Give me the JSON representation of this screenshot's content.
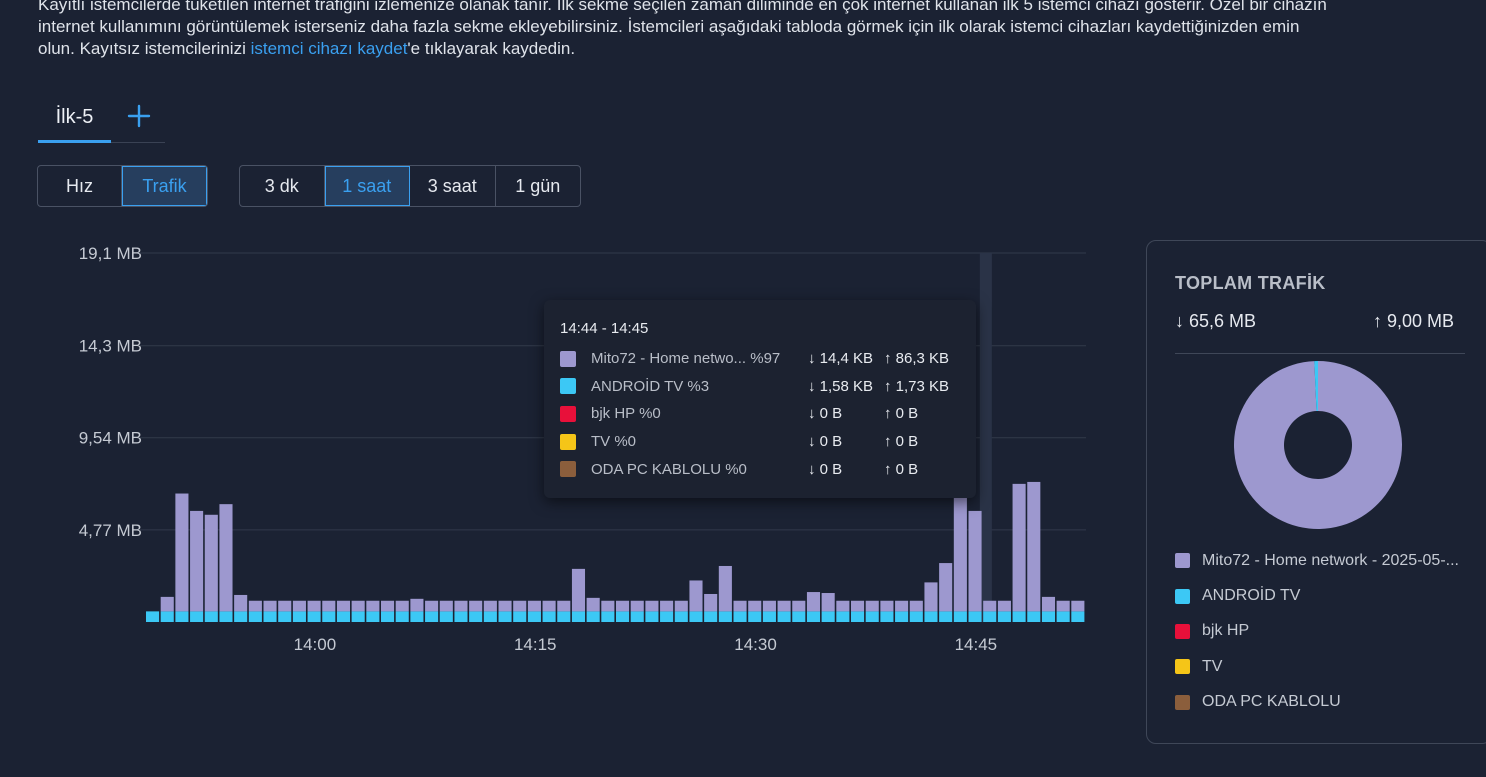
{
  "intro": {
    "line1": "Kayıtlı istemcilerde tüketilen internet trafiğini izlemenize olanak tanır. İlk sekme seçilen zaman diliminde en çok internet kullanan ilk 5 istemci cihazı gösterir. Özel bir cihazın",
    "line2": "internet kullanımını görüntülemek isterseniz daha fazla sekme ekleyebilirsiniz. İstemcileri aşağıdaki tabloda görmek için ilk olarak istemci cihazları kaydettiğinizden emin",
    "line3_pre": "olun. Kayıtsız istemcilerinizi ",
    "link": "istemci cihazı kaydet",
    "line3_post": "'e tıklayarak kaydedin."
  },
  "tabs": {
    "active": "İlk-5",
    "add_icon": "plus-icon"
  },
  "metric_toggle": [
    {
      "label": "Hız",
      "active": false
    },
    {
      "label": "Trafik",
      "active": true
    }
  ],
  "time_range": [
    {
      "label": "3 dk",
      "active": false
    },
    {
      "label": "1 saat",
      "active": true
    },
    {
      "label": "3 saat",
      "active": false
    },
    {
      "label": "1 gün",
      "active": false
    }
  ],
  "colors": {
    "mito": "#9d98cf",
    "android": "#3cc8f5",
    "bjk": "#e8103a",
    "tv": "#f5c518",
    "odapc": "#8b5e3c",
    "accent": "#3aa0f0"
  },
  "chart_data": {
    "type": "bar",
    "stacked": true,
    "unit": "MB",
    "ylim": [
      0,
      19.1
    ],
    "y_ticks": [
      "19,1 MB",
      "14,3 MB",
      "9,54 MB",
      "4,77 MB"
    ],
    "y_tick_values": [
      19.1,
      14.3,
      9.54,
      4.77
    ],
    "x_ticks": [
      "14:00",
      "14:15",
      "14:30",
      "14:45"
    ],
    "x_tick_index": [
      11,
      26,
      41,
      56
    ],
    "grid": true,
    "series": [
      {
        "name": "ANDROİD TV",
        "color": "#3cc8f5",
        "values": [
          0.55,
          0.55,
          0.55,
          0.55,
          0.55,
          0.55,
          0.55,
          0.55,
          0.55,
          0.55,
          0.55,
          0.55,
          0.55,
          0.55,
          0.55,
          0.55,
          0.55,
          0.55,
          0.55,
          0.55,
          0.55,
          0.55,
          0.55,
          0.55,
          0.55,
          0.55,
          0.55,
          0.55,
          0.55,
          0.55,
          0.55,
          0.55,
          0.55,
          0.55,
          0.55,
          0.55,
          0.55,
          0.55,
          0.55,
          0.55,
          0.55,
          0.55,
          0.55,
          0.55,
          0.55,
          0.55,
          0.55,
          0.55,
          0.55,
          0.55,
          0.55,
          0.55,
          0.55,
          0.55,
          0.55,
          0.55,
          0.55,
          0.55,
          0.55,
          0.55,
          0.55,
          0.55,
          0.55,
          0.55
        ]
      },
      {
        "name": "Mito72 - Home network - 2025-05-...",
        "color": "#9d98cf",
        "values": [
          0,
          0.75,
          6.1,
          5.2,
          5.0,
          5.55,
          0.85,
          0.55,
          0.55,
          0.55,
          0.55,
          0.55,
          0.55,
          0.55,
          0.55,
          0.55,
          0.55,
          0.55,
          0.65,
          0.55,
          0.55,
          0.55,
          0.55,
          0.55,
          0.55,
          0.55,
          0.55,
          0.55,
          0.55,
          2.2,
          0.7,
          0.55,
          0.55,
          0.55,
          0.55,
          0.55,
          0.55,
          1.6,
          0.9,
          2.35,
          0.55,
          0.55,
          0.55,
          0.55,
          0.55,
          1.0,
          0.95,
          0.55,
          0.55,
          0.55,
          0.55,
          0.55,
          0.55,
          1.5,
          2.5,
          6.45,
          5.2,
          0.55,
          0.55,
          6.6,
          6.7,
          0.75,
          0.55,
          0.55
        ]
      }
    ],
    "highlight_index": 56
  },
  "tooltip": {
    "title": "14:44 - 14:45",
    "rows": [
      {
        "name": "Mito72 - Home netwo... %97",
        "down": "↓ 14,4 KB",
        "up": "↑ 86,3 KB",
        "color": "#9d98cf"
      },
      {
        "name": "ANDROİD TV %3",
        "down": "↓ 1,58 KB",
        "up": "↑ 1,73 KB",
        "color": "#3cc8f5"
      },
      {
        "name": "bjk HP %0",
        "down": "↓ 0 B",
        "up": "↑ 0 B",
        "color": "#e8103a"
      },
      {
        "name": "TV %0",
        "down": "↓ 0 B",
        "up": "↑ 0 B",
        "color": "#f5c518"
      },
      {
        "name": "ODA PC KABLOLU %0",
        "down": "↓ 0 B",
        "up": "↑ 0 B",
        "color": "#8b5e3c"
      }
    ]
  },
  "summary": {
    "title": "TOPLAM TRAFİK",
    "down": "↓ 65,6 MB",
    "up": "↑ 9,00 MB",
    "donut": [
      {
        "name": "Mito72",
        "percent": 99.3,
        "color": "#9d98cf"
      },
      {
        "name": "ANDROİD TV",
        "percent": 0.7,
        "color": "#3cc8f5"
      }
    ],
    "legend": [
      {
        "label": "Mito72 - Home network - 2025-05-...",
        "color": "#9d98cf"
      },
      {
        "label": "ANDROİD TV",
        "color": "#3cc8f5"
      },
      {
        "label": "bjk HP",
        "color": "#e8103a"
      },
      {
        "label": "TV",
        "color": "#f5c518"
      },
      {
        "label": "ODA PC KABLOLU",
        "color": "#8b5e3c"
      }
    ]
  }
}
